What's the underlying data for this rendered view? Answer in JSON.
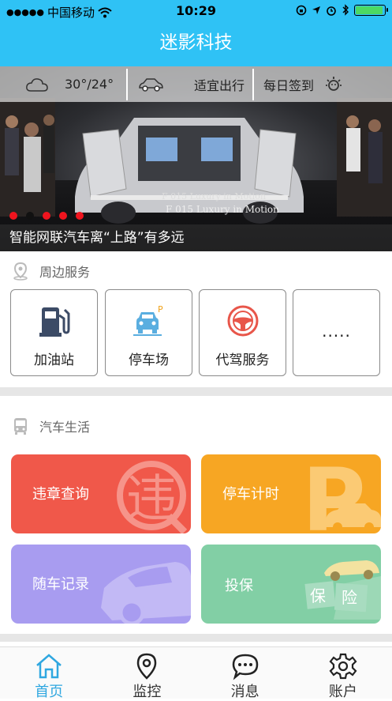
{
  "status_bar": {
    "carrier": "中国移动",
    "time": "10:29"
  },
  "app_title": "迷影科技",
  "banner": {
    "weather": "30°/24°",
    "travel_tip": "适宜出行",
    "checkin": "每日签到",
    "headline": "智能网联汽车离“上路”有多远",
    "plate_text_1": "F 015 Luxury in Motion",
    "plate_text_2": "F 015 Luxury in Motion",
    "page_count": 5,
    "active_page": 2
  },
  "nearby": {
    "title": "周边服务",
    "items": [
      {
        "label": "加油站",
        "icon": "fuel-pump-icon"
      },
      {
        "label": "停车场",
        "icon": "parking-car-icon"
      },
      {
        "label": "代驾服务",
        "icon": "steering-wheel-icon"
      },
      {
        "label": "·····",
        "icon": "more-icon"
      }
    ]
  },
  "car_life": {
    "title": "汽车生活",
    "tiles": [
      {
        "label": "违章查询",
        "color": "#f0584a",
        "deco": "违"
      },
      {
        "label": "停车计时",
        "color": "#f7a623",
        "deco": "P"
      },
      {
        "label": "随车记录",
        "color": "#a89cf0",
        "deco": "car"
      },
      {
        "label": "投保",
        "color": "#82cfa5",
        "deco_text_1": "保",
        "deco_text_2": "险"
      }
    ]
  },
  "tabbar": {
    "tabs": [
      {
        "label": "首页",
        "icon": "home-icon",
        "active": true
      },
      {
        "label": "监控",
        "icon": "location-pin-icon",
        "active": false
      },
      {
        "label": "消息",
        "icon": "chat-bubble-icon",
        "active": false
      },
      {
        "label": "账户",
        "icon": "gear-icon",
        "active": false
      }
    ]
  },
  "colors": {
    "primary": "#2fc2f5",
    "tab_active": "#2fa7e0",
    "pager_active": "#f0141e"
  }
}
